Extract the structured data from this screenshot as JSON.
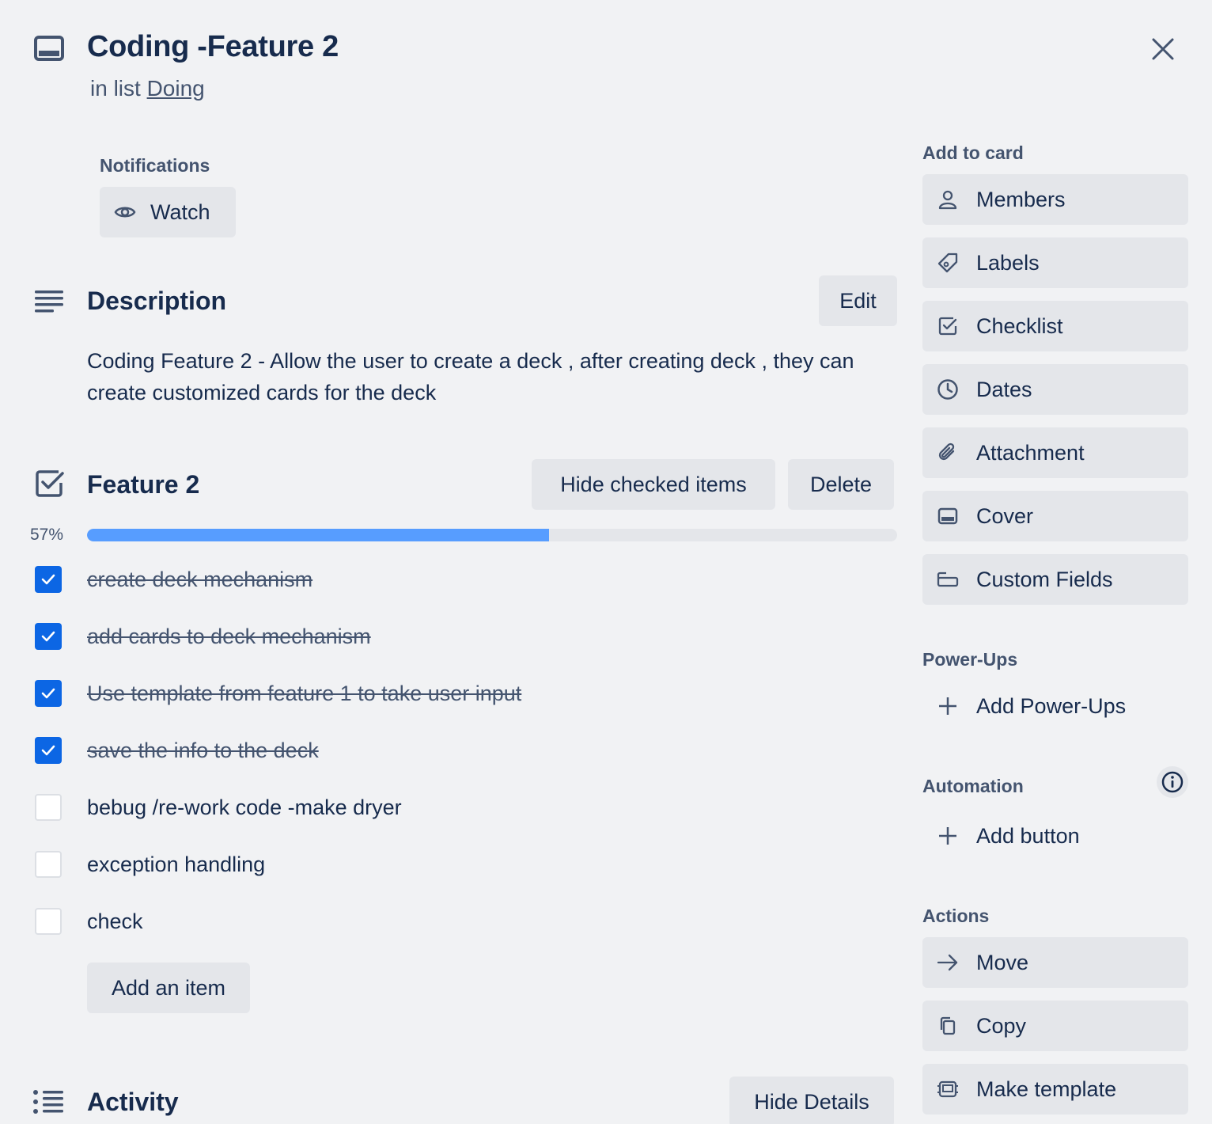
{
  "card": {
    "title": "Coding -Feature 2",
    "list_prefix": "in list ",
    "list_name": "Doing"
  },
  "notifications": {
    "label": "Notifications",
    "watch_label": "Watch"
  },
  "description": {
    "title": "Description",
    "edit_label": "Edit",
    "text": "Coding Feature 2 - Allow the user to create a deck , after creating deck , they can create customized cards for the deck"
  },
  "checklist": {
    "title": "Feature 2",
    "hide_checked_label": "Hide checked items",
    "delete_label": "Delete",
    "progress_text": "57%",
    "progress": 0.57,
    "items": [
      {
        "text": "create deck mechanism",
        "checked": true
      },
      {
        "text": "add cards to deck mechanism",
        "checked": true
      },
      {
        "text": "Use template from feature 1 to take user input",
        "checked": true
      },
      {
        "text": "save the info to the deck",
        "checked": true
      },
      {
        "text": "bebug /re-work code -make dryer",
        "checked": false
      },
      {
        "text": "exception handling",
        "checked": false
      },
      {
        "text": "check",
        "checked": false
      }
    ],
    "add_item_label": "Add an item"
  },
  "activity": {
    "title": "Activity",
    "hide_details_label": "Hide Details"
  },
  "sidebar": {
    "add_to_card_label": "Add to card",
    "add_to_card": [
      {
        "label": "Members",
        "icon": "person-icon"
      },
      {
        "label": "Labels",
        "icon": "tag-icon"
      },
      {
        "label": "Checklist",
        "icon": "checklist-icon"
      },
      {
        "label": "Dates",
        "icon": "clock-icon"
      },
      {
        "label": "Attachment",
        "icon": "paperclip-icon"
      },
      {
        "label": "Cover",
        "icon": "cover-icon"
      },
      {
        "label": "Custom Fields",
        "icon": "custom-fields-icon"
      }
    ],
    "powerups_label": "Power-Ups",
    "add_powerups_label": "Add Power-Ups",
    "automation_label": "Automation",
    "add_button_label": "Add button",
    "actions_label": "Actions",
    "actions": [
      {
        "label": "Move",
        "icon": "arrow-right-icon"
      },
      {
        "label": "Copy",
        "icon": "copy-icon"
      },
      {
        "label": "Make template",
        "icon": "template-icon"
      }
    ]
  }
}
